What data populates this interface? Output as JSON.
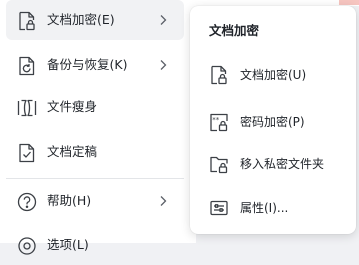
{
  "colors": {
    "text": "#1f2329",
    "icon_stroke": "#3c4046",
    "active_bg": "#f1f2f4",
    "divider": "#e3e5e8",
    "page_bg": "#f0f1f4"
  },
  "menu": {
    "items": [
      {
        "label": "文档加密(E)",
        "icon": "lock-document-icon",
        "has_submenu": true,
        "active": true
      },
      {
        "label": "备份与恢复(K)",
        "icon": "backup-restore-icon",
        "has_submenu": true
      },
      {
        "label": "文件瘦身",
        "icon": "compress-file-icon",
        "has_submenu": false
      },
      {
        "label": "文档定稿",
        "icon": "finalize-document-icon",
        "has_submenu": false
      },
      {
        "label": "帮助(H)",
        "icon": "help-icon",
        "has_submenu": true
      },
      {
        "label": "选项(L)",
        "icon": "options-icon",
        "has_submenu": false
      }
    ]
  },
  "submenu": {
    "title": "文档加密",
    "items": [
      {
        "label": "文档加密(U)",
        "icon": "lock-document-icon"
      },
      {
        "label": "密码加密(P)",
        "icon": "password-lock-icon"
      },
      {
        "label": "移入私密文件夹",
        "icon": "private-folder-icon"
      },
      {
        "label": "属性(I)...",
        "icon": "properties-icon"
      }
    ]
  }
}
